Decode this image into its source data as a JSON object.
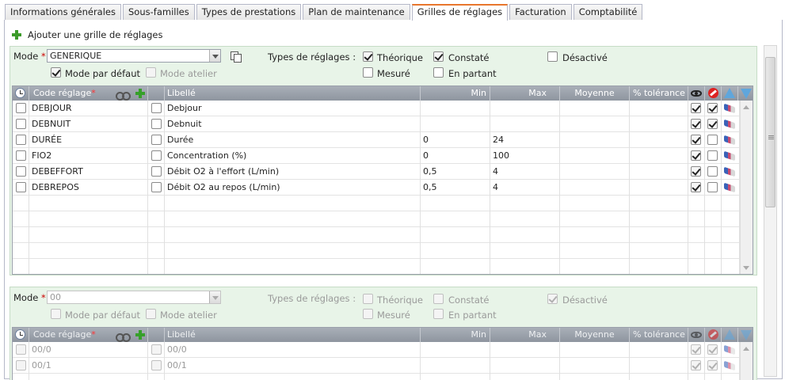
{
  "tabs": [
    "Informations générales",
    "Sous-familles",
    "Types de prestations",
    "Plan de maintenance",
    "Grilles de réglages",
    "Facturation",
    "Comptabilité"
  ],
  "active_tab": "Grilles de réglages",
  "add_link": "Ajouter une grille de réglages",
  "labels": {
    "mode": "Mode",
    "required": "*",
    "types": "Types de réglages :",
    "mode_defaut": "Mode par défaut",
    "mode_atelier": "Mode atelier",
    "theorique": "Théorique",
    "constate": "Constaté",
    "desactive": "Désactivé",
    "mesure": "Mesuré",
    "en_partant": "En partant"
  },
  "columns": {
    "code": "Code réglage",
    "libelle": "Libellé",
    "min": "Min",
    "max": "Max",
    "moyenne": "Moyenne",
    "tolerance": "% tolérance"
  },
  "grid1": {
    "mode_value": "GENERIQUE",
    "rows": [
      {
        "code": "DEBJOUR",
        "libelle": "Debjour",
        "min": "",
        "max": ""
      },
      {
        "code": "DEBNUIT",
        "libelle": "Debnuit",
        "min": "",
        "max": ""
      },
      {
        "code": "DURÉE",
        "libelle": "Durée",
        "min": "0",
        "max": "24"
      },
      {
        "code": "FIO2",
        "libelle": "Concentration (%)",
        "min": "0",
        "max": "100"
      },
      {
        "code": "DEBEFFORT",
        "libelle": "Débit O2 à l'effort (L/min)",
        "min": "0,5",
        "max": "4"
      },
      {
        "code": "DEBREPOS",
        "libelle": "Débit O2 au repos (L/min)",
        "min": "0,5",
        "max": "4"
      }
    ]
  },
  "grid2": {
    "mode_value": "00",
    "rows": [
      {
        "code": "00/0",
        "libelle": "00/0"
      },
      {
        "code": "00/1",
        "libelle": "00/1"
      }
    ]
  }
}
